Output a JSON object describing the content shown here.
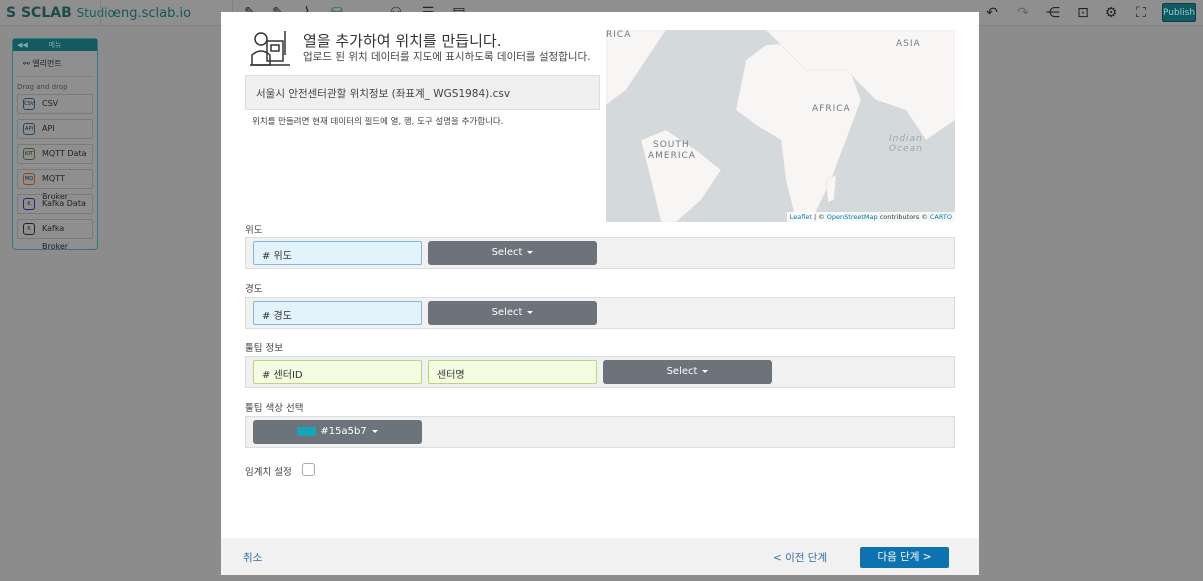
{
  "app": {
    "logo": "SCLAB",
    "logo_suffix": "Studio",
    "url": "eng.sclab.io",
    "publish": "Publish"
  },
  "toolbar": {
    "icons": [
      "edit-icon",
      "edit-doc-icon",
      "chart-icon",
      "database-icon",
      "cloud-icon",
      "users-icon",
      "list-icon",
      "card-icon"
    ],
    "right_icons": [
      "undo-icon",
      "redo-icon",
      "share-icon",
      "unlock-icon",
      "settings-icon",
      "fullscreen-icon"
    ]
  },
  "sidebar": {
    "title": "메뉴",
    "element": "엘리먼트",
    "drag_label": "Drag and drop",
    "items": [
      {
        "label": "CSV",
        "icon": "CSV"
      },
      {
        "label": "API",
        "icon": "API"
      },
      {
        "label": "MQTT Data",
        "icon": "IOT"
      },
      {
        "label": "MQTT Broker",
        "icon": "MQ"
      },
      {
        "label": "Kafka Data",
        "icon": "K"
      },
      {
        "label": "Kafka Broker",
        "icon": "K"
      }
    ]
  },
  "modal": {
    "title": "열을 추가하여 위치를 만듭니다.",
    "subtitle": "업로드 된 위치 데이터를 지도에 표시하도록 데이터를 설정합니다.",
    "file_name": "서울시 안전센터관할 위치정보 (좌표계_ WGS1984).csv",
    "hint": "위치를 만들려면 현재 데이터의 필드에 열, 행, 도구 설명을 추가합니다.",
    "map": {
      "labels": [
        "RICA",
        "ASIA",
        "AFRICA",
        "SOUTH",
        "AMERICA",
        "Indian",
        "Ocean"
      ],
      "attribution": {
        "leaflet": "Leaflet",
        "sep1": " | © ",
        "osm": "OpenStreetMap",
        "mid": " contributors © ",
        "carto": "CARTO"
      }
    },
    "latitude": {
      "label": "위도",
      "field": "# 위도",
      "select": "Select"
    },
    "longitude": {
      "label": "경도",
      "field": "# 경도",
      "select": "Select"
    },
    "tooltip": {
      "label": "툴팁 정보",
      "field1": "# 센터ID",
      "field2": "센터명",
      "select": "Select"
    },
    "tooltip_color": {
      "label": "툴팁 색상 선택",
      "value": "#15a5b7"
    },
    "threshold": {
      "label": "임계치 설정",
      "checked": false
    },
    "footer": {
      "cancel": "취소",
      "prev": "< 이전 단계",
      "next": "다음 단계 >"
    }
  }
}
